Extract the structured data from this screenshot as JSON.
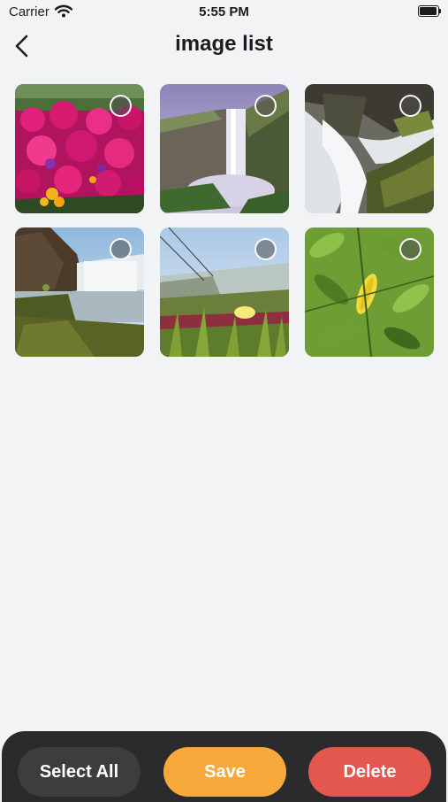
{
  "status": {
    "carrier": "Carrier",
    "time": "5:55 PM"
  },
  "nav": {
    "title": "image list"
  },
  "images": [
    {
      "subject": "pink flowers",
      "selected": false
    },
    {
      "subject": "waterfall cliff",
      "selected": false
    },
    {
      "subject": "rocky waterfall",
      "selected": false
    },
    {
      "subject": "misty waterfall",
      "selected": false
    },
    {
      "subject": "coastal plants",
      "selected": false
    },
    {
      "subject": "green leaves",
      "selected": false
    }
  ],
  "actions": {
    "select_all": "Select All",
    "save": "Save",
    "delete": "Delete"
  },
  "colors": {
    "save": "#f6a83b",
    "delete": "#e4574f",
    "select_all": "#3d3d40",
    "bar": "#2b2b2d"
  }
}
